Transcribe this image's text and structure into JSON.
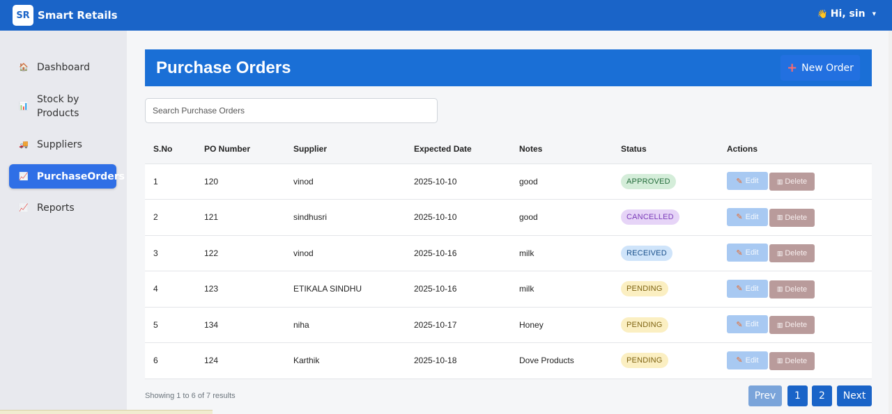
{
  "app": {
    "logo": "SR",
    "name": "Smart Retails"
  },
  "user": {
    "greeting": "Hi, sin",
    "wave": "👋"
  },
  "sidebar": {
    "items": [
      {
        "label": "Dashboard",
        "icon": "🏠"
      },
      {
        "label": "Stock by Products",
        "icon": "📊"
      },
      {
        "label": "Suppliers",
        "icon": "🚚"
      },
      {
        "label": "PurchaseOrders",
        "icon": "📈"
      },
      {
        "label": "Reports",
        "icon": "📈"
      }
    ]
  },
  "header": {
    "title": "Purchase Orders",
    "new_order_label": "New Order",
    "plus": "+"
  },
  "search": {
    "placeholder": "Search Purchase Orders"
  },
  "table": {
    "columns": [
      "S.No",
      "PO Number",
      "Supplier",
      "Expected Date",
      "Notes",
      "Status",
      "Actions"
    ],
    "rows": [
      {
        "sno": "1",
        "po": "120",
        "supplier": "vinod",
        "date": "2025-10-10",
        "notes": "good",
        "status": "APPROVED"
      },
      {
        "sno": "2",
        "po": "121",
        "supplier": "sindhusri",
        "date": "2025-10-10",
        "notes": "good",
        "status": "CANCELLED"
      },
      {
        "sno": "3",
        "po": "122",
        "supplier": "vinod",
        "date": "2025-10-16",
        "notes": "milk",
        "status": "RECEIVED"
      },
      {
        "sno": "4",
        "po": "123",
        "supplier": "ETIKALA SINDHU",
        "date": "2025-10-16",
        "notes": "milk",
        "status": "PENDING"
      },
      {
        "sno": "5",
        "po": "134",
        "supplier": "niha",
        "date": "2025-10-17",
        "notes": "Honey",
        "status": "PENDING"
      },
      {
        "sno": "6",
        "po": "124",
        "supplier": "Karthik",
        "date": "2025-10-18",
        "notes": "Dove Products",
        "status": "PENDING"
      }
    ],
    "edit_label": "Edit",
    "delete_label": "Delete"
  },
  "footer": {
    "showing": "Showing 1 to 6 of 7 results"
  },
  "pagination": {
    "prev": "Prev",
    "pages": [
      "1",
      "2"
    ],
    "next": "Next"
  }
}
